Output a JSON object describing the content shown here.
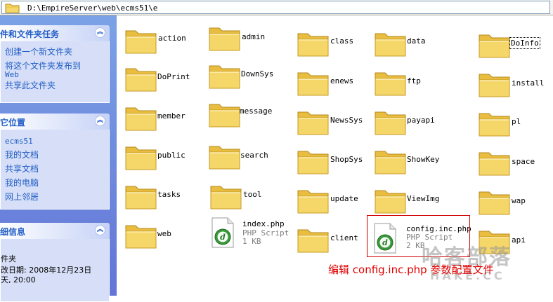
{
  "address_bar": {
    "path": "D:\\EmpireServer\\web\\ecms51\\e"
  },
  "task_pane": {
    "file_tasks": {
      "title": "件和文件夹任务",
      "links": [
        "创建一个新文件夹",
        "将这个文件夹发布到",
        "Web",
        "共享此文件夹"
      ]
    },
    "other_places": {
      "title": "它位置",
      "links": [
        "ecms51",
        "我的文档",
        "共享文档",
        "我的电脑",
        "网上邻居"
      ]
    },
    "details": {
      "title": "细信息",
      "lines": [
        "件夹",
        "改日期: 2008年12月23日",
        "天, 20:00"
      ]
    }
  },
  "folders": [
    "action",
    "admin",
    "class",
    "data",
    "DoInfo",
    "DoPrint",
    "DownSys",
    "enews",
    "ftp",
    "install",
    "member",
    "message",
    "NewsSys",
    "payapi",
    "pl",
    "public",
    "search",
    "ShopSys",
    "ShowKey",
    "space",
    "tasks",
    "tool",
    "update",
    "ViewImg",
    "wap",
    "web",
    "client",
    "api"
  ],
  "files": [
    {
      "name": "index.php",
      "type": "PHP Script",
      "size": "1 KB"
    },
    {
      "name": "config.inc.php",
      "type": "PHP Script",
      "size": "2 KB"
    }
  ],
  "annotation": {
    "caption": "编辑 config.inc.php 参数配置文件"
  },
  "watermark": {
    "cn": "哈客部落",
    "en": "HAKE.CC"
  },
  "colors": {
    "task_pane": "#7ba2e7",
    "panel_title": "#215dc6",
    "folder": "#f5d668",
    "highlight": "#d00000",
    "caption": "#e00000"
  }
}
